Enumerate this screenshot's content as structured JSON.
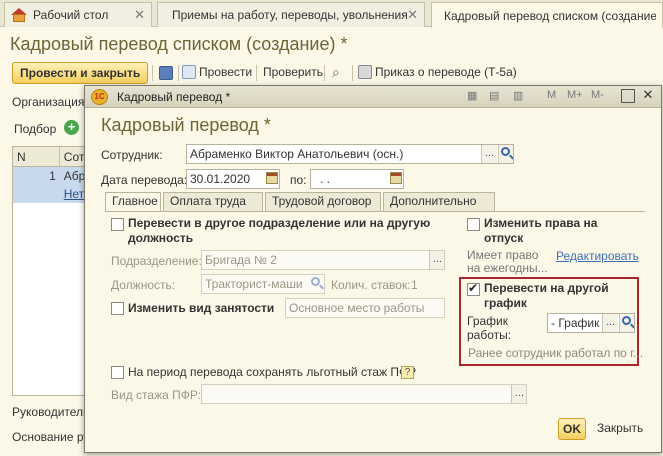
{
  "tabs": [
    {
      "label": "Рабочий стол"
    },
    {
      "label": "Приемы на работу, переводы, увольнения"
    },
    {
      "label": "Кадровый перевод списком (создание)"
    }
  ],
  "back_form": {
    "title": "Кадровый перевод списком (создание) *",
    "toolbar": {
      "post_and_close": "Провести и закрыть",
      "post": "Провести",
      "check": "Проверить",
      "order": "Приказ о переводе (Т-5а)"
    },
    "organization_label": "Организация:",
    "select_label": "Подбор",
    "grid": {
      "columns": [
        "N",
        "Сот"
      ],
      "rows": [
        {
          "n": "1",
          "name": "Абр"
        },
        {
          "n": "",
          "name": "Нет"
        }
      ]
    },
    "head_label": "Руководитель",
    "basis_label": "Основание ру"
  },
  "modal": {
    "window_title": "Кадровый перевод *",
    "toolbar_text": {
      "m": "M",
      "m_plus": "M+",
      "m_minus": "M-"
    },
    "heading": "Кадровый перевод *",
    "employee_label": "Сотрудник:",
    "employee_value": "Абраменко Виктор Анатольевич (осн.)",
    "date_label": "Дата перевода:",
    "date_value": "30.01.2020",
    "to_label": "по:",
    "to_value": ". .",
    "tabs": [
      "Главное",
      "Оплата труда",
      "Трудовой договор",
      "Дополнительно"
    ],
    "main": {
      "transfer_dept": "Перевести в другое подразделение или на другую должность",
      "dept_label": "Подразделение:",
      "dept_value": "Бригада № 2",
      "position_label": "Должность:",
      "position_value": "Тракторист-маши",
      "rates_label": "Колич. ставок:",
      "rates_value": "1",
      "change_employment": "Изменить вид занятости",
      "employment_value": "Основное место работы",
      "change_vacation": "Изменить права на отпуск",
      "vacation_hint": "Имеет право на ежегодны...",
      "edit_link": "Редактировать",
      "other_schedule": "Перевести на другой график",
      "schedule_label": "График работы:",
      "schedule_value": "- График р",
      "schedule_hint": "Ранее сотрудник работал по г...",
      "pfr_keep": "На период перевода сохранять льготный стаж ПФР",
      "pfr_type_label": "Вид стажа ПФР:",
      "pfr_type_value": ""
    },
    "ok": "OK",
    "close": "Закрыть"
  },
  "colors": {
    "accent_title": "#6e6436",
    "highlight_border": "#a8262b",
    "link": "#3d6fb5",
    "primary_button": "#f2cf5d"
  }
}
